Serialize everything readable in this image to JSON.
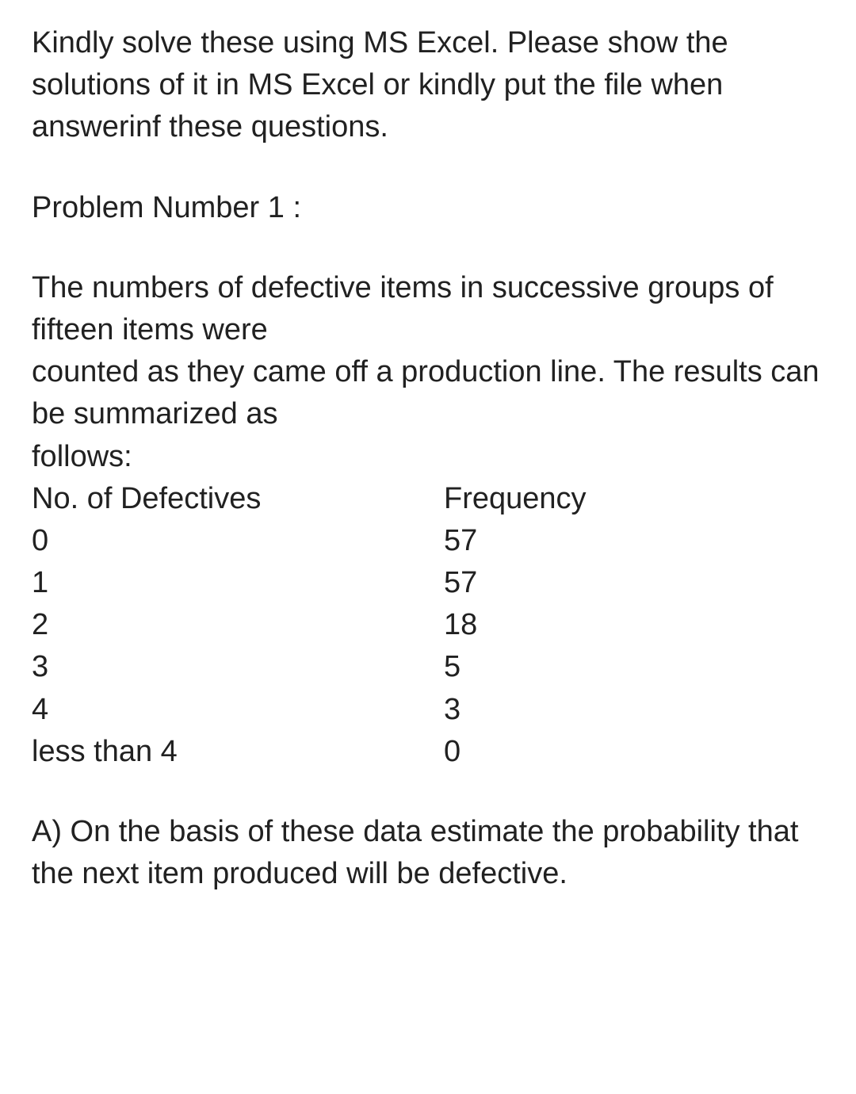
{
  "intro": "Kindly solve these using MS Excel. Please show the solutions of it in MS Excel or kindly put the file when answerinf these questions.",
  "problem_label": "Problem Number 1 :",
  "problem_text_line1": "The numbers of defective items in successive groups of fifteen items were",
  "problem_text_line2": "counted as they came off a production line. The results can be summarized as",
  "problem_text_line3": "follows:",
  "table": {
    "header_left": "No. of Defectives",
    "header_right": "Frequency",
    "rows": [
      {
        "left": "0",
        "right": "57"
      },
      {
        "left": "1",
        "right": "57"
      },
      {
        "left": "2",
        "right": "18"
      },
      {
        "left": "3",
        "right": "5"
      },
      {
        "left": "4",
        "right": "3"
      },
      {
        "left": "less than 4",
        "right": "0"
      }
    ]
  },
  "question_a": "A) On the basis of these data estimate the probability that the next item produced will be defective."
}
